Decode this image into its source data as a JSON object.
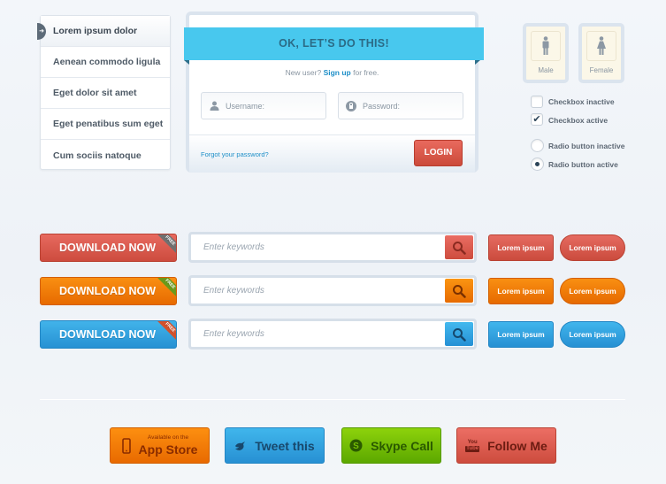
{
  "menu": {
    "items": [
      {
        "label": "Lorem ipsum dolor",
        "active": true
      },
      {
        "label": "Aenean commodo ligula"
      },
      {
        "label": "Eget dolor sit amet"
      },
      {
        "label": "Eget penatibus sum eget"
      },
      {
        "label": "Cum sociis natoque"
      }
    ]
  },
  "login": {
    "title": "OK, LET’S DO THIS!",
    "new_user_prefix": "New user?",
    "signup_label": "Sign up",
    "new_user_suffix": "for free.",
    "username_placeholder": "Username:",
    "password_placeholder": "Password:",
    "forgot_label": "Forgot your password?",
    "login_label": "LOGIN"
  },
  "gender": {
    "male_label": "Male",
    "female_label": "Female"
  },
  "controls": {
    "checkbox_inactive": {
      "label": "Checkbox inactive",
      "checked": false
    },
    "checkbox_active": {
      "label": "Checkbox active",
      "checked": true
    },
    "radio_inactive": {
      "label": "Radio button inactive",
      "selected": false
    },
    "radio_active": {
      "label": "Radio button active",
      "selected": true
    }
  },
  "download": {
    "label": "DOWNLOAD NOW",
    "ribbon": "FREE",
    "colors": {
      "red": "#d85547",
      "orange": "#f07a06",
      "blue": "#32a3df"
    },
    "ribbon_colors": {
      "red": "#6f6f6f",
      "orange": "#6a9a1a",
      "blue": "#d2512c"
    }
  },
  "search": {
    "placeholder": "Enter keywords"
  },
  "buttons": {
    "label": "Lorem ipsum"
  },
  "social": {
    "appstore_small": "Available on the",
    "appstore_big": "App Store",
    "tweet": "Tweet this",
    "skype": "Skype Call",
    "follow": "Follow Me",
    "youtube_icon_text_top": "You",
    "youtube_icon_text_bottom": "Tube"
  },
  "colors": {
    "accent_blue": "#48c8ee",
    "link": "#1e8fc8",
    "red": "#d85547",
    "orange": "#f07a06",
    "green": "#75bd05"
  }
}
